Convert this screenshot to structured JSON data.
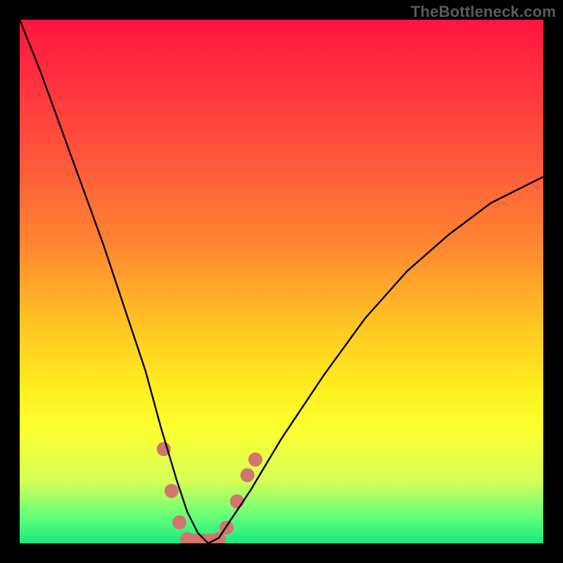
{
  "watermark": "TheBottleneck.com",
  "chart_data": {
    "type": "line",
    "title": "",
    "xlabel": "",
    "ylabel": "",
    "xlim": [
      0,
      100
    ],
    "ylim": [
      0,
      100
    ],
    "background_gradient": [
      "#ff153f",
      "#ff5a3a",
      "#ffc423",
      "#fdff30",
      "#17e87d"
    ],
    "series": [
      {
        "name": "bottleneck-curve",
        "color": "#000000",
        "x": [
          0,
          4,
          8,
          12,
          16,
          20,
          24,
          27,
          30,
          32,
          34,
          36,
          38,
          40,
          44,
          50,
          58,
          66,
          74,
          82,
          90,
          100
        ],
        "values": [
          100,
          90,
          79,
          68,
          57,
          45,
          33,
          22,
          12,
          6,
          2,
          0,
          1,
          4,
          10,
          20,
          32,
          43,
          52,
          59,
          65,
          70
        ]
      }
    ],
    "markers": {
      "name": "highlight-dots",
      "color": "#d1766f",
      "radius_px": 10,
      "points": [
        {
          "x": 27.5,
          "y": 18
        },
        {
          "x": 29.0,
          "y": 10
        },
        {
          "x": 30.5,
          "y": 4
        },
        {
          "x": 32.0,
          "y": 0.8
        },
        {
          "x": 33.5,
          "y": 0.5
        },
        {
          "x": 35.0,
          "y": 0.5
        },
        {
          "x": 36.5,
          "y": 0.5
        },
        {
          "x": 38.0,
          "y": 0.8
        },
        {
          "x": 39.5,
          "y": 3
        },
        {
          "x": 41.5,
          "y": 8
        },
        {
          "x": 43.5,
          "y": 13
        },
        {
          "x": 45.0,
          "y": 16
        }
      ]
    }
  }
}
